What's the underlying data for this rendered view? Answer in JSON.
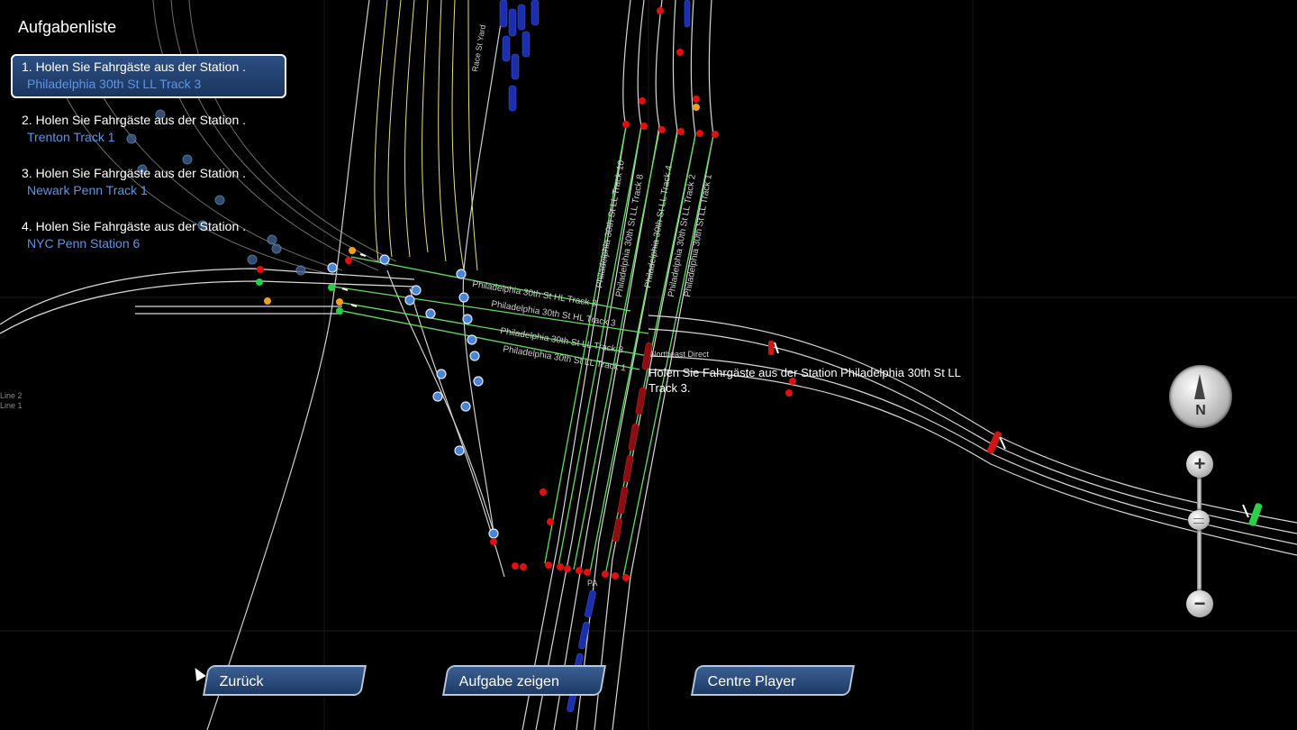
{
  "task_list": {
    "title": "Aufgabenliste",
    "items": [
      {
        "line1": "1. Holen Sie Fahrgäste aus der Station .",
        "line2": "Philadelphia 30th St LL Track 3",
        "active": true
      },
      {
        "line1": "2. Holen Sie Fahrgäste aus der Station .",
        "line2": "Trenton Track 1",
        "active": false
      },
      {
        "line1": "3. Holen Sie Fahrgäste aus der Station .",
        "line2": "Newark Penn Track 1",
        "active": false
      },
      {
        "line1": "4. Holen Sie Fahrgäste aus der Station .",
        "line2": "NYC Penn Station 6",
        "active": false
      }
    ]
  },
  "map": {
    "objective_label": "Holen Sie Fahrgäste aus der Station Philadelphia 30th St LL Track 3.",
    "track_labels": [
      "Philadelphia 30th St HL Track 3",
      "Philadelphia 30th St LL Track 10",
      "Philadelphia 30th St LL Track 8",
      "Philadelphia 30th St LL Track 4",
      "Philadelphia 30th St LL Track 2",
      "Philadelphia 30th St LL Track 1",
      "Northeast Direct",
      "Race St Yard",
      "Line 2",
      "Line 1",
      "PA"
    ]
  },
  "compass": {
    "label": "N"
  },
  "zoom": {
    "in_label": "+",
    "out_label": "−"
  },
  "buttons": {
    "back": "Zurück",
    "show_task": "Aufgabe zeigen",
    "centre_player": "Centre Player"
  },
  "colors": {
    "highlight_track": "#5ee05e",
    "yard_track": "#e6e27a",
    "track": "#d8d8d8",
    "signal_red": "#e01010",
    "node_blue": "#4a84d6",
    "train_blue": "#1b2fae",
    "train_red": "#8b0f12",
    "accent_blue": "#5b96e6"
  }
}
